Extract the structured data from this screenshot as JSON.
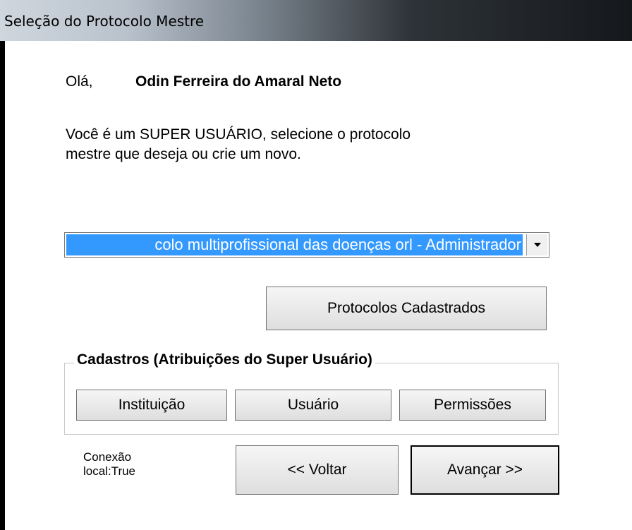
{
  "window": {
    "title": "Seleção do Protocolo Mestre"
  },
  "greeting": {
    "label": "Olá,",
    "user_name": "Odin Ferreira do Amaral Neto"
  },
  "instruction": {
    "line1": "Você é um SUPER USUÁRIO, selecione o protocolo",
    "line2": "mestre que deseja ou crie um novo."
  },
  "protocol_select": {
    "selected_value": "colo multiprofissional das doenças orl - Administrador",
    "arrow_icon": "chevron-down-icon"
  },
  "buttons": {
    "protocolos_cadastrados": "Protocolos Cadastrados",
    "voltar": "<< Voltar",
    "avancar": "Avançar >>"
  },
  "cadastros": {
    "title": "Cadastros (Atribuições do Super Usuário)",
    "instituicao": "Instituição",
    "usuario": "Usuário",
    "permissoes": "Permissões"
  },
  "status": {
    "line1": "Conexão",
    "line2": "local:True"
  },
  "colors": {
    "selection_highlight": "#3399ff"
  }
}
